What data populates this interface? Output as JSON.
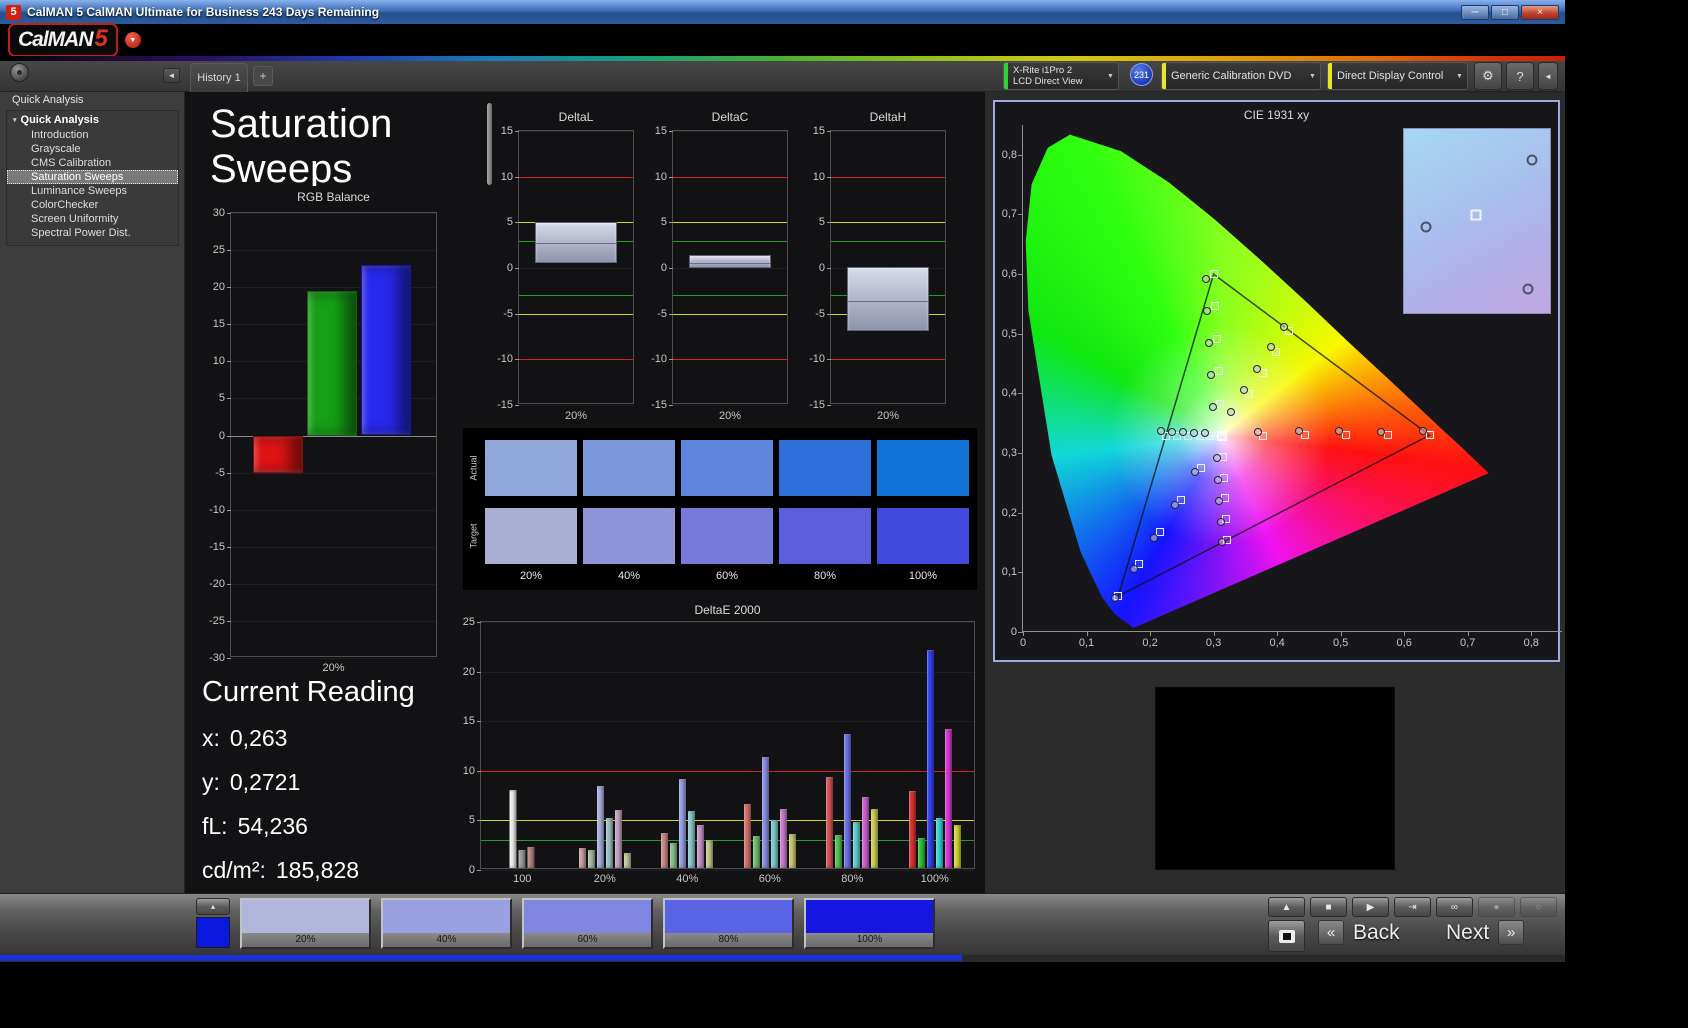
{
  "window": {
    "icon_text": "5",
    "title": "CalMAN 5 CalMAN Ultimate for Business 243 Days Remaining",
    "minimize_icon": "─",
    "maximize_icon": "□",
    "close_icon": "×",
    "logo_text": "CalMAN",
    "logo_number": "5",
    "logo_dropdown_icon": "▼"
  },
  "toolbar": {
    "tab_label": "History 1",
    "add_tab_label": "+",
    "sidebar_collapse_icon": "◄",
    "dropdown_icon": "▼",
    "meter": {
      "line1": "X-Rite i1Pro 2",
      "line2": "LCD Direct View",
      "status_color": "#2ed52e",
      "badge": "231"
    },
    "pattern_source": {
      "label": "Generic Calibration DVD",
      "status_color": "#e6e62a"
    },
    "display_control": {
      "label": "Direct Display Control",
      "status_color": "#e6e62a"
    },
    "gear_icon": "⚙",
    "help_icon": "?",
    "panel_collapse_icon": "◄"
  },
  "sidebar": {
    "panel_header": "Quick Analysis",
    "root_label": "Quick Analysis",
    "root_icon": "▾",
    "items": [
      {
        "label": "Introduction",
        "selected": false
      },
      {
        "label": "Grayscale",
        "selected": false
      },
      {
        "label": "CMS Calibration",
        "selected": false
      },
      {
        "label": "Saturation Sweeps",
        "selected": true
      },
      {
        "label": "Luminance Sweeps",
        "selected": false
      },
      {
        "label": "ColorChecker",
        "selected": false
      },
      {
        "label": "Screen Uniformity",
        "selected": false
      },
      {
        "label": "Spectral Power Dist.",
        "selected": false
      }
    ]
  },
  "main": {
    "title_line1": "Saturation",
    "title_line2": "Sweeps",
    "current_reading": {
      "heading": "Current Reading",
      "rows": [
        {
          "label": "x:",
          "value": "0,263"
        },
        {
          "label": "y:",
          "value": "0,2721"
        },
        {
          "label": "fL:",
          "value": "54,236"
        },
        {
          "label": "cd/m²:",
          "value": "185,828"
        }
      ]
    }
  },
  "chart_data": [
    {
      "id": "rgb_balance",
      "type": "bar",
      "title": "RGB Balance",
      "categories": [
        "20%"
      ],
      "ylim": [
        -30,
        30
      ],
      "yticks": [
        30,
        25,
        20,
        15,
        10,
        5,
        0,
        -5,
        -10,
        -15,
        -20,
        -25,
        -30
      ],
      "series": [
        {
          "name": "Red",
          "color": "#e01414",
          "values": [
            -5
          ]
        },
        {
          "name": "Green",
          "color": "#16a016",
          "values": [
            19.5
          ]
        },
        {
          "name": "Blue",
          "color": "#2828f0",
          "values": [
            23
          ]
        }
      ]
    },
    {
      "id": "delta_l",
      "type": "range-bar",
      "title": "DeltaL",
      "categories": [
        "20%"
      ],
      "ylim": [
        -15,
        15
      ],
      "yticks": [
        15,
        10,
        5,
        0,
        -5,
        -10,
        -15
      ],
      "ref_lines": [
        {
          "value": 10,
          "color": "#d42222"
        },
        {
          "value": 5,
          "color": "#d4d422"
        },
        {
          "value": 3,
          "color": "#22a022"
        },
        {
          "value": -3,
          "color": "#22a022"
        },
        {
          "value": -5,
          "color": "#d4d422"
        },
        {
          "value": -10,
          "color": "#d42222"
        }
      ],
      "range": {
        "from": 0.6,
        "to": 5.0,
        "mid": 2.9
      }
    },
    {
      "id": "delta_c",
      "type": "range-bar",
      "title": "DeltaC",
      "categories": [
        "20%"
      ],
      "ylim": [
        -15,
        15
      ],
      "yticks": [
        15,
        10,
        5,
        0,
        -5,
        -10,
        -15
      ],
      "ref_lines": [
        {
          "value": 10,
          "color": "#d42222"
        },
        {
          "value": 5,
          "color": "#d4d422"
        },
        {
          "value": 3,
          "color": "#22a022"
        },
        {
          "value": -3,
          "color": "#22a022"
        },
        {
          "value": -5,
          "color": "#d4d422"
        },
        {
          "value": -10,
          "color": "#d42222"
        }
      ],
      "range": {
        "from": 0.0,
        "to": 1.4,
        "mid": 0.7
      }
    },
    {
      "id": "delta_h",
      "type": "range-bar",
      "title": "DeltaH",
      "categories": [
        "20%"
      ],
      "ylim": [
        -15,
        15
      ],
      "yticks": [
        15,
        10,
        5,
        0,
        -5,
        -10,
        -15
      ],
      "ref_lines": [
        {
          "value": 10,
          "color": "#d42222"
        },
        {
          "value": 5,
          "color": "#d4d422"
        },
        {
          "value": 3,
          "color": "#22a022"
        },
        {
          "value": -3,
          "color": "#22a022"
        },
        {
          "value": -5,
          "color": "#d4d422"
        },
        {
          "value": -10,
          "color": "#d42222"
        }
      ],
      "range": {
        "from": -6.9,
        "to": 0.1,
        "mid": -3.5
      }
    },
    {
      "id": "saturation_swatches",
      "type": "table",
      "row_labels": [
        "Actual",
        "Target"
      ],
      "col_labels": [
        "20%",
        "40%",
        "60%",
        "80%",
        "100%"
      ],
      "actual_colors": [
        "#93a8da",
        "#7d97db",
        "#5d85dc",
        "#2e70da",
        "#1273d6"
      ],
      "target_colors": [
        "#a9aed4",
        "#8f94d8",
        "#7479da",
        "#5a60dc",
        "#4349de"
      ]
    },
    {
      "id": "deltae_2000",
      "type": "bar",
      "title": "DeltaE 2000",
      "ylim": [
        0,
        25
      ],
      "yticks": [
        0,
        5,
        10,
        15,
        20,
        25
      ],
      "ref_lines": [
        {
          "value": 10,
          "color": "#d42222"
        },
        {
          "value": 5,
          "color": "#d4d422"
        },
        {
          "value": 3,
          "color": "#22a022"
        }
      ],
      "groups": [
        {
          "label": "100",
          "bars": [
            {
              "color": "#f0f0f0",
              "value": 7.9
            },
            {
              "color": "#a0a0a0",
              "value": 1.8
            },
            {
              "color": "#bc8484",
              "value": 2.1
            }
          ]
        },
        {
          "label": "20%",
          "bars": [
            {
              "color": "#c9a2a2",
              "value": 2.0
            },
            {
              "color": "#a6c2a6",
              "value": 1.8
            },
            {
              "color": "#aab0e0",
              "value": 8.3
            },
            {
              "color": "#a0c6c6",
              "value": 5.0
            },
            {
              "color": "#c6a6c6",
              "value": 5.8
            },
            {
              "color": "#c6c6a0",
              "value": 1.5
            }
          ]
        },
        {
          "label": "40%",
          "bars": [
            {
              "color": "#cf8c8c",
              "value": 3.5
            },
            {
              "color": "#8cc28c",
              "value": 2.5
            },
            {
              "color": "#9aa2e4",
              "value": 9.0
            },
            {
              "color": "#8ccaca",
              "value": 5.7
            },
            {
              "color": "#ca94ca",
              "value": 4.3
            },
            {
              "color": "#c8c88a",
              "value": 2.8
            }
          ]
        },
        {
          "label": "60%",
          "bars": [
            {
              "color": "#d67272",
              "value": 6.5
            },
            {
              "color": "#72c272",
              "value": 3.2
            },
            {
              "color": "#8a92e8",
              "value": 11.2
            },
            {
              "color": "#7ccece",
              "value": 4.8
            },
            {
              "color": "#ce7ece",
              "value": 5.9
            },
            {
              "color": "#caca72",
              "value": 3.4
            }
          ]
        },
        {
          "label": "80%",
          "bars": [
            {
              "color": "#dc5656",
              "value": 9.2
            },
            {
              "color": "#56c456",
              "value": 3.3
            },
            {
              "color": "#6c76ec",
              "value": 13.5
            },
            {
              "color": "#60d2d2",
              "value": 4.6
            },
            {
              "color": "#d264d2",
              "value": 7.2
            },
            {
              "color": "#d0d056",
              "value": 5.9
            }
          ]
        },
        {
          "label": "100%",
          "bars": [
            {
              "color": "#e03434",
              "value": 7.8
            },
            {
              "color": "#34c634",
              "value": 3.0
            },
            {
              "color": "#3444f2",
              "value": 22.0
            },
            {
              "color": "#3ad6d6",
              "value": 5.0
            },
            {
              "color": "#da3ada",
              "value": 14.0
            },
            {
              "color": "#d6d634",
              "value": 4.3
            }
          ]
        }
      ]
    },
    {
      "id": "cie_1931",
      "type": "scatter",
      "title": "CIE 1931 xy",
      "xlim": [
        0,
        0.85
      ],
      "ylim": [
        0,
        0.85
      ],
      "tick_step": 0.1,
      "xtick_labels": [
        "0",
        "0,1",
        "0,2",
        "0,3",
        "0,4",
        "0,5",
        "0,6",
        "0,7",
        "0,8"
      ],
      "ytick_labels": [
        "0",
        "0,1",
        "0,2",
        "0,3",
        "0,4",
        "0,5",
        "0,6",
        "0,7",
        "0,8"
      ],
      "gamut_triangle": [
        [
          0.64,
          0.33
        ],
        [
          0.3,
          0.6
        ],
        [
          0.15,
          0.06
        ]
      ],
      "white_point": [
        0.3127,
        0.329
      ],
      "targets": [
        [
          0.378,
          0.329
        ],
        [
          0.444,
          0.33
        ],
        [
          0.509,
          0.33
        ],
        [
          0.575,
          0.33
        ],
        [
          0.64,
          0.33
        ],
        [
          0.31,
          0.383
        ],
        [
          0.308,
          0.437
        ],
        [
          0.305,
          0.492
        ],
        [
          0.303,
          0.546
        ],
        [
          0.3,
          0.6
        ],
        [
          0.28,
          0.275
        ],
        [
          0.248,
          0.221
        ],
        [
          0.215,
          0.168
        ],
        [
          0.183,
          0.114
        ],
        [
          0.15,
          0.06
        ],
        [
          0.295,
          0.329
        ],
        [
          0.278,
          0.329
        ],
        [
          0.26,
          0.329
        ],
        [
          0.243,
          0.329
        ],
        [
          0.225,
          0.329
        ],
        [
          0.315,
          0.294
        ],
        [
          0.316,
          0.259
        ],
        [
          0.318,
          0.224
        ],
        [
          0.319,
          0.189
        ],
        [
          0.321,
          0.154
        ],
        [
          0.334,
          0.364
        ],
        [
          0.356,
          0.399
        ],
        [
          0.377,
          0.435
        ],
        [
          0.398,
          0.47
        ],
        [
          0.419,
          0.505
        ]
      ],
      "measurements": [
        [
          0.37,
          0.336
        ],
        [
          0.434,
          0.337
        ],
        [
          0.498,
          0.337
        ],
        [
          0.563,
          0.336
        ],
        [
          0.63,
          0.337
        ],
        [
          0.299,
          0.378
        ],
        [
          0.296,
          0.431
        ],
        [
          0.292,
          0.485
        ],
        [
          0.29,
          0.538
        ],
        [
          0.288,
          0.592
        ],
        [
          0.271,
          0.268
        ],
        [
          0.239,
          0.213
        ],
        [
          0.206,
          0.158
        ],
        [
          0.175,
          0.106
        ],
        [
          0.145,
          0.057
        ],
        [
          0.287,
          0.333
        ],
        [
          0.269,
          0.334
        ],
        [
          0.252,
          0.335
        ],
        [
          0.235,
          0.336
        ],
        [
          0.218,
          0.337
        ],
        [
          0.305,
          0.291
        ],
        [
          0.307,
          0.255
        ],
        [
          0.309,
          0.22
        ],
        [
          0.311,
          0.185
        ],
        [
          0.313,
          0.151
        ],
        [
          0.327,
          0.369
        ],
        [
          0.348,
          0.405
        ],
        [
          0.369,
          0.441
        ],
        [
          0.39,
          0.477
        ],
        [
          0.411,
          0.512
        ]
      ],
      "inset_points": [
        {
          "shape": "circle",
          "x": 15,
          "y": 53
        },
        {
          "shape": "circle",
          "x": 88,
          "y": 17
        },
        {
          "shape": "circle",
          "x": 85,
          "y": 87
        },
        {
          "shape": "square",
          "x": 49,
          "y": 47
        }
      ]
    }
  ],
  "patch_bar": {
    "collapse_icon": "▴",
    "current_patch_color": "#0a18e0",
    "swatches": [
      {
        "label": "20%",
        "color": "#b2b6dc"
      },
      {
        "label": "40%",
        "color": "#9aa0e0"
      },
      {
        "label": "60%",
        "color": "#7e86e2"
      },
      {
        "label": "80%",
        "color": "#5a64e4"
      },
      {
        "label": "100%",
        "color": "#1616e2"
      }
    ],
    "transport": [
      {
        "name": "eject-button",
        "glyph": "▲",
        "disabled": false
      },
      {
        "name": "stop-button",
        "glyph": "■",
        "disabled": false
      },
      {
        "name": "play-button",
        "glyph": "▶",
        "disabled": false
      },
      {
        "name": "skip-button",
        "glyph": "⇥",
        "disabled": false
      },
      {
        "name": "loop-button",
        "glyph": "∞",
        "disabled": false
      },
      {
        "name": "record-button",
        "glyph": "●",
        "disabled": true
      },
      {
        "name": "standby-button",
        "glyph": "○",
        "disabled": true
      }
    ],
    "back_icon": "«",
    "back_label": "Back",
    "next_label": "Next",
    "next_icon": "»"
  }
}
